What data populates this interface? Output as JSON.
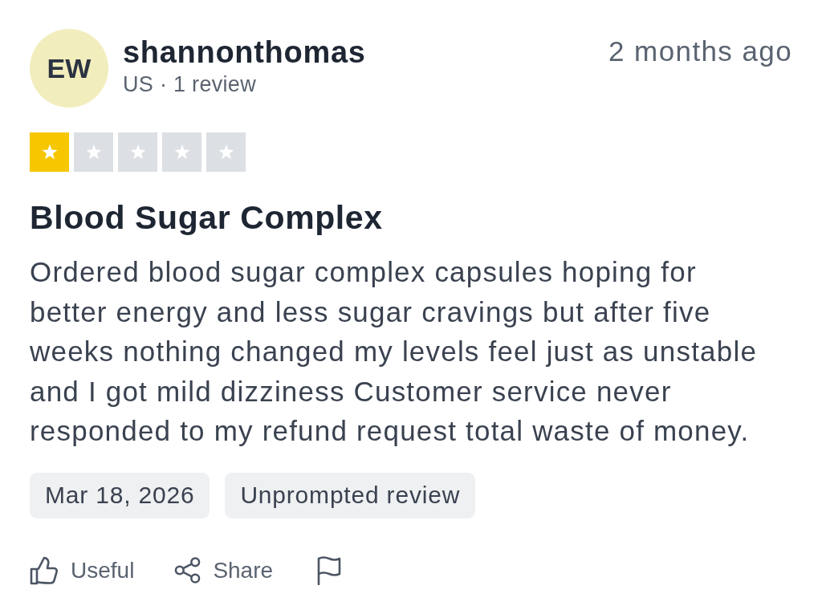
{
  "review": {
    "avatar": {
      "initials": "EW"
    },
    "author": "shannonthomas",
    "meta": "US · 1 review",
    "time": "2 months ago",
    "stars": 1,
    "title": "Blood Sugar Complex",
    "body": "Ordered blood sugar complex capsules hoping for better energy and less sugar cravings but after five weeks nothing changed my levels feel just as unstable and I got mild dizziness Customer service never responded to my refund request total waste of money.",
    "tags": [
      "Mar 18, 2026",
      "Unprompted review"
    ],
    "actions": [
      {
        "kind": "useful",
        "label": "Useful"
      },
      {
        "kind": "share",
        "label": "Share"
      },
      {
        "kind": "report"
      }
    ]
  }
}
